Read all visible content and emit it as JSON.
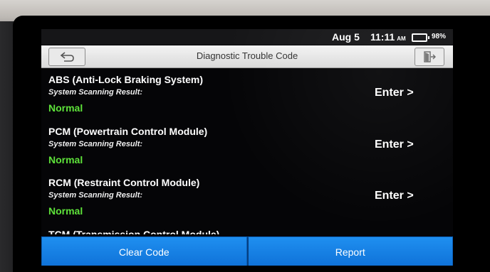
{
  "status_bar": {
    "date": "Aug 5",
    "time": "11:11",
    "ampm": "AM",
    "battery": "98%"
  },
  "header": {
    "title": "Diagnostic Trouble Code",
    "back_icon": "back-arrow-icon",
    "exit_icon": "exit-icon"
  },
  "modules": [
    {
      "name": "ABS (Anti-Lock Braking System)",
      "subtitle": "System Scanning Result:",
      "status": "Normal",
      "action": "Enter >"
    },
    {
      "name": "PCM (Powertrain Control Module)",
      "subtitle": "System Scanning Result:",
      "status": "Normal",
      "action": "Enter >"
    },
    {
      "name": "RCM (Restraint Control Module)",
      "subtitle": "System Scanning Result:",
      "status": "Normal",
      "action": "Enter >"
    }
  ],
  "partial_item": "TCM (Transmission Control Module)",
  "footer": {
    "clear_label": "Clear Code",
    "report_label": "Report"
  },
  "colors": {
    "status_normal": "#5ee23a",
    "button_blue": "#1a84e8",
    "title_bar": "#e6e6e6"
  }
}
